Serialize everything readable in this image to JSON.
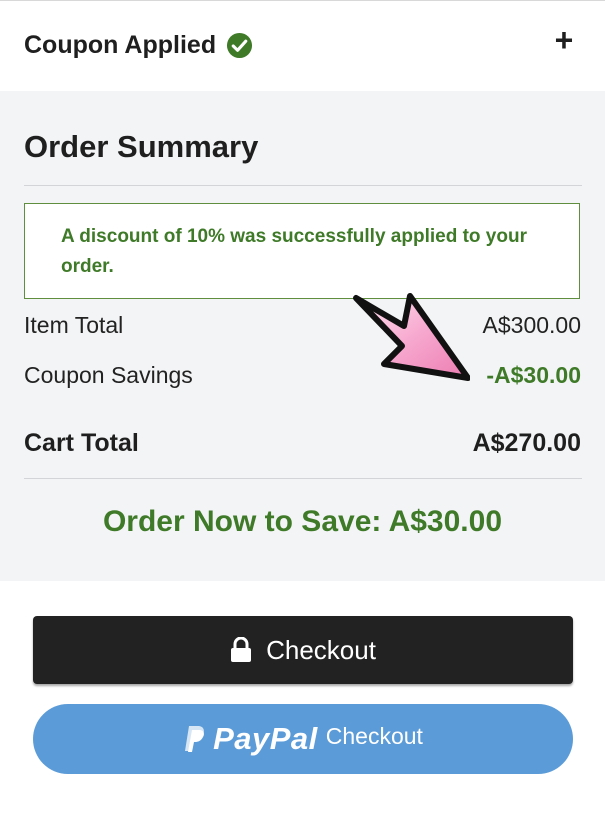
{
  "coupon": {
    "title": "Coupon Applied",
    "expand_icon": "plus-icon",
    "status_icon": "check-circle-icon"
  },
  "summary": {
    "title": "Order Summary",
    "notice": "A discount of 10% was successfully applied to your order.",
    "rows": [
      {
        "label": "Item Total",
        "value": "A$300.00"
      },
      {
        "label": "Coupon Savings",
        "value": "-A$30.00"
      }
    ],
    "total": {
      "label": "Cart Total",
      "value": "A$270.00"
    },
    "save_banner": "Order Now to Save: A$30.00"
  },
  "buttons": {
    "checkout_label": "Checkout",
    "checkout_icon": "lock-icon",
    "paypal_word": "PayPal",
    "paypal_label": "Checkout"
  },
  "colors": {
    "accent_green": "#3e7a28",
    "checkout_dark": "#222222",
    "paypal_blue": "#5b9bd8",
    "arrow_pink": "#ee8fc0"
  }
}
